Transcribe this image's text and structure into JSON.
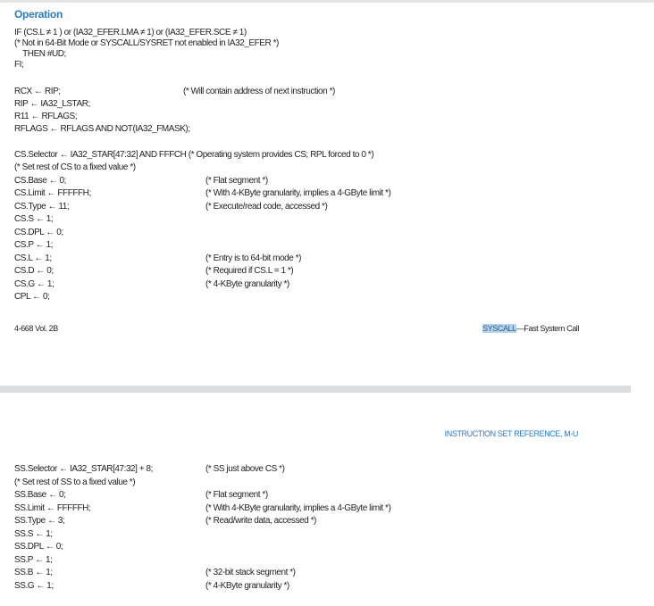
{
  "page1": {
    "heading": "Operation",
    "lines": [
      {
        "code": "IF (CS.L ≠ 1 ) or (IA32_EFER.LMA ≠ 1) or (IA32_EFER.SCE ≠ 1)",
        "comment": ""
      },
      {
        "code": "(* Not in 64-Bit Mode or SYSCALL/SYSRET not enabled in IA32_EFER *)",
        "comment": ""
      },
      {
        "code": "    THEN #UD;",
        "comment": ""
      },
      {
        "code": "FI;",
        "comment": ""
      },
      {
        "code": "RCX ← RIP;",
        "comment": "(* Will contain address of next instruction *)"
      },
      {
        "code": "RIP ← IA32_LSTAR;",
        "comment": ""
      },
      {
        "code": "R11 ← RFLAGS;",
        "comment": ""
      },
      {
        "code": "RFLAGS ← RFLAGS AND NOT(IA32_FMASK);",
        "comment": ""
      },
      {
        "code": "CS.Selector ← IA32_STAR[47:32] AND FFFCH (* Operating system provides CS; RPL forced to 0 *)",
        "comment": ""
      },
      {
        "code": "(* Set rest of CS to a fixed value *)",
        "comment": ""
      },
      {
        "code": "CS.Base ← 0;",
        "comment": "(* Flat segment *)"
      },
      {
        "code": "CS.Limit ← FFFFFH;",
        "comment": "(* With 4-KByte granularity, implies a 4-GByte limit *)"
      },
      {
        "code": "CS.Type ← 11;",
        "comment": "(* Execute/read code, accessed *)"
      },
      {
        "code": "CS.S ← 1;",
        "comment": ""
      },
      {
        "code": "CS.DPL ← 0;",
        "comment": ""
      },
      {
        "code": "CS.P ← 1;",
        "comment": ""
      },
      {
        "code": "CS.L ← 1;",
        "comment": "(* Entry is to 64-bit mode *)"
      },
      {
        "code": "CS.D ← 0;",
        "comment": "(* Required if CS.L = 1 *)"
      },
      {
        "code": "CS.G ← 1;",
        "comment": "(* 4-KByte granularity *)"
      },
      {
        "code": "CPL ← 0;",
        "comment": ""
      }
    ],
    "footer_left": "4-668  Vol. 2B",
    "footer_highlight": "SYSCALL",
    "footer_right": "—Fast System Call",
    "highlight_color": "#b5d3ea"
  },
  "page2": {
    "header": "INSTRUCTION SET REFERENCE, M-U",
    "lines": [
      {
        "code": "SS.Selector ← IA32_STAR[47:32] + 8;",
        "comment": "(* SS just above CS *)"
      },
      {
        "code": "(* Set rest of SS to a fixed value *)",
        "comment": ""
      },
      {
        "code": "SS.Base ← 0;",
        "comment": "(* Flat segment *)"
      },
      {
        "code": "SS.Limit ← FFFFFH;",
        "comment": "(* With 4-KByte granularity, implies a 4-GByte limit *)"
      },
      {
        "code": "SS.Type ← 3;",
        "comment": "(* Read/write data, accessed *)"
      },
      {
        "code": "SS.S ← 1;",
        "comment": ""
      },
      {
        "code": "SS.DPL ← 0;",
        "comment": ""
      },
      {
        "code": "SS.P ← 1;",
        "comment": ""
      },
      {
        "code": "SS.B ← 1;",
        "comment": "(* 32-bit stack segment *)"
      },
      {
        "code": "SS.G ← 1;",
        "comment": "(* 4-KByte granularity *)"
      }
    ]
  },
  "accent_color": "#2d7bbf"
}
